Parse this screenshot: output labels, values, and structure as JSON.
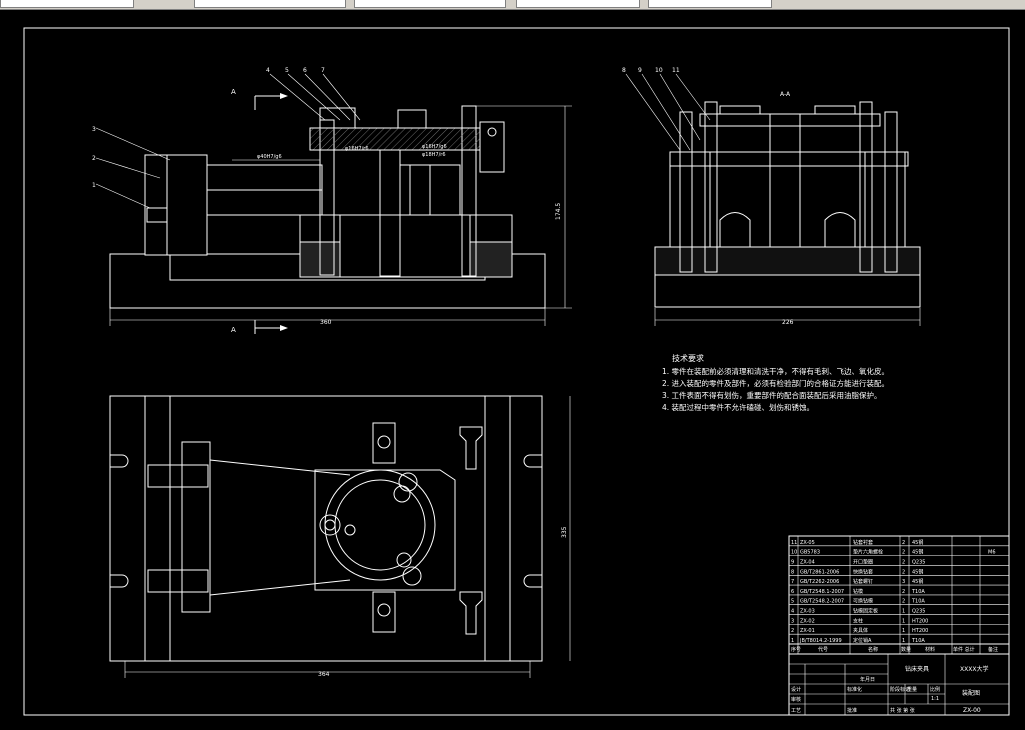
{
  "tech_requirements": {
    "heading": "技术要求",
    "items": [
      "1. 零件在装配前必须清理和清洗干净，不得有毛刺、飞边、氧化皮。",
      "2. 进入装配的零件及部件，必须有检验部门的合格证方能进行装配。",
      "3. 工件表面不得有划伤，重要部件的配合面装配后采用油脂保护。",
      "4. 装配过程中零件不允许磕碰、划伤和锈蚀。"
    ]
  },
  "views": {
    "section_label_a_top": "A",
    "section_label_a_bottom": "A",
    "section_label_aa": "A-A",
    "dim_front_width": "360",
    "dim_front_height": "174.5",
    "dim_side_width": "226",
    "dim_top_width": "364",
    "dim_top_height": "335",
    "fit_label_1": "φ40H7/g6",
    "fit_label_2": "φ16H7/g6",
    "fit_label_3": "φ18H7/r6",
    "fit_label_4": "φ16H7/r6"
  },
  "balloons_front": [
    "4",
    "5",
    "6",
    "7",
    "3",
    "2",
    "1"
  ],
  "balloons_side": [
    "8",
    "9",
    "10",
    "11"
  ],
  "bom": [
    {
      "no": "11",
      "code": "ZX-05",
      "name": "钻套衬套",
      "qty": "2",
      "mat": "45钢",
      "note": ""
    },
    {
      "no": "10",
      "code": "GB5783",
      "name": "垫片六角螺栓",
      "qty": "2",
      "mat": "45钢",
      "note": "M6"
    },
    {
      "no": "9",
      "code": "ZX-04",
      "name": "开口垫圈",
      "qty": "2",
      "mat": "Q235",
      "note": ""
    },
    {
      "no": "8",
      "code": "GB/T2861-2006",
      "name": "快换钻套",
      "qty": "2",
      "mat": "45钢",
      "note": ""
    },
    {
      "no": "7",
      "code": "GB/T2262-2006",
      "name": "钻套螺钉",
      "qty": "3",
      "mat": "45钢",
      "note": ""
    },
    {
      "no": "6",
      "code": "GB/T2548.1-2007",
      "name": "钻模",
      "qty": "2",
      "mat": "T10A",
      "note": ""
    },
    {
      "no": "5",
      "code": "GB/T2548.2-2007",
      "name": "可换钻模",
      "qty": "2",
      "mat": "T10A",
      "note": ""
    },
    {
      "no": "4",
      "code": "ZX-03",
      "name": "钻模固定板",
      "qty": "1",
      "mat": "Q235",
      "note": ""
    },
    {
      "no": "3",
      "code": "ZX-02",
      "name": "支柱",
      "qty": "1",
      "mat": "HT200",
      "note": ""
    },
    {
      "no": "2",
      "code": "ZX-01",
      "name": "夹具体",
      "qty": "1",
      "mat": "HT200",
      "note": ""
    },
    {
      "no": "1",
      "code": "JB/T8014.2-1999",
      "name": "定位销A",
      "qty": "1",
      "mat": "T10A",
      "note": ""
    }
  ],
  "bom_header": {
    "no": "序号",
    "code": "代号",
    "name": "名称",
    "qty": "数量",
    "mat": "材料",
    "weight": "单件 总计",
    "note": "备注"
  },
  "title_block": {
    "part_name": "钻床夹具",
    "company": "XXXX大学",
    "drawing_no": "ZX-00",
    "assembly": "装配图",
    "scale": "1:1",
    "sheet": "共 张 第 张",
    "design": "设计",
    "check": "审核",
    "process": "工艺",
    "approve": "批准",
    "stage": "阶段标记",
    "weight": "重量",
    "ratio": "比例",
    "std": "标准化",
    "date": "年月日"
  }
}
